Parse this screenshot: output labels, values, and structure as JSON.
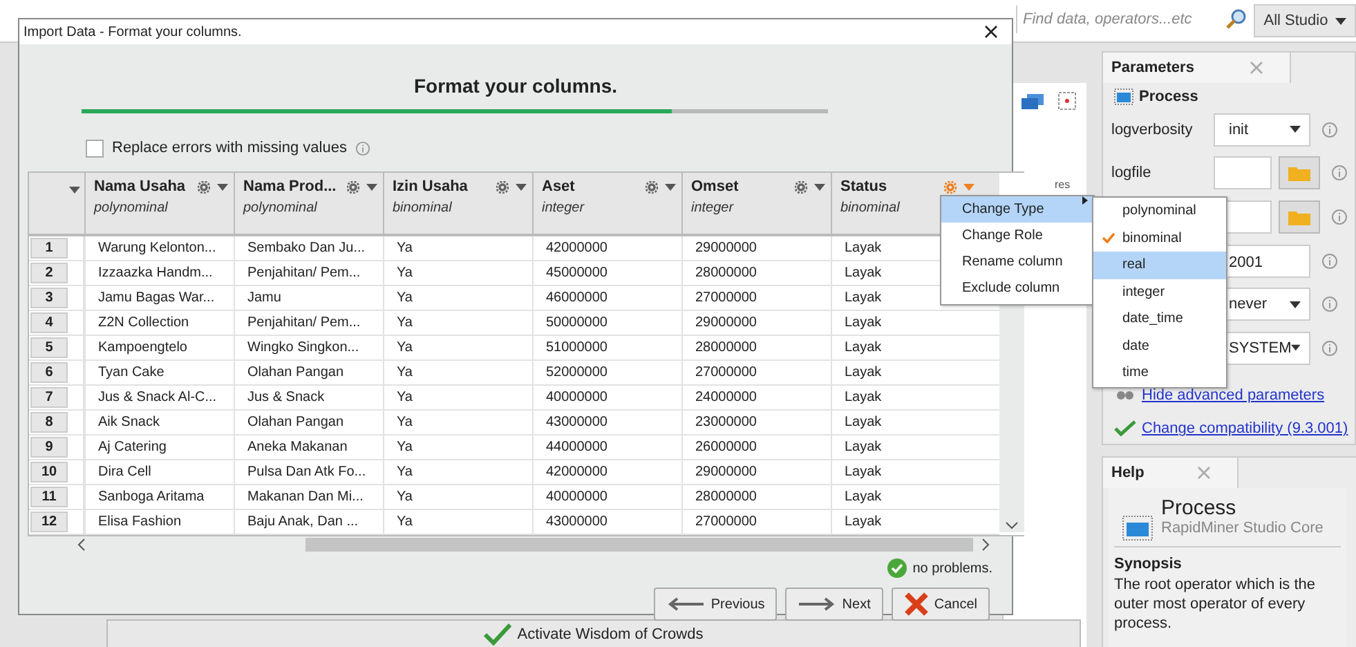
{
  "app": {
    "search": {
      "placeholder": "Find data, operators...etc"
    },
    "scope": "All Studio",
    "canvas_label": "res"
  },
  "parameters": {
    "tab": "Parameters",
    "operator": "Process",
    "rows": [
      {
        "label": "logverbosity",
        "kind": "select",
        "value": "init"
      },
      {
        "label": "logfile",
        "kind": "file"
      },
      {
        "kind": "file"
      },
      {
        "kind": "text",
        "value": "2001"
      },
      {
        "kind": "select",
        "value": "never"
      },
      {
        "kind": "select",
        "value": "SYSTEM"
      }
    ],
    "links": [
      {
        "label": "Hide advanced parameters",
        "kind": "hide"
      },
      {
        "label": "Change compatibility (9.3.001)",
        "kind": "check"
      }
    ]
  },
  "help": {
    "tab": "Help",
    "title": "Process",
    "subtitle": "RapidMiner Studio Core",
    "section": "Synopsis",
    "text": "The root operator which is the outer most operator of every process."
  },
  "wisdom_button": "Activate Wisdom of Crowds",
  "dialog": {
    "title": "Import Data - Format your columns.",
    "heading": "Format your columns.",
    "progress": {
      "level": 0.79
    },
    "replace_errors": {
      "label": "Replace errors with missing values",
      "checked": false
    },
    "columns": [
      {
        "name": "Nama Usaha",
        "type": "polynominal",
        "active": false
      },
      {
        "name": "Nama Prod...",
        "type": "polynominal",
        "active": false
      },
      {
        "name": "Izin Usaha",
        "type": "binominal",
        "active": false
      },
      {
        "name": "Aset",
        "type": "integer",
        "active": false
      },
      {
        "name": "Omset",
        "type": "integer",
        "active": false
      },
      {
        "name": "Status",
        "type": "binominal",
        "active": true
      }
    ],
    "rows": [
      {
        "num": "1",
        "cells": [
          "Warung Kelonton...",
          "Sembako Dan Ju...",
          "Ya",
          "42000000",
          "29000000",
          "Layak"
        ]
      },
      {
        "num": "2",
        "cells": [
          "Izzaazka Handm...",
          "Penjahitan/ Pem...",
          "Ya",
          "45000000",
          "28000000",
          "Layak"
        ]
      },
      {
        "num": "3",
        "cells": [
          "Jamu Bagas War...",
          "Jamu",
          "Ya",
          "46000000",
          "27000000",
          "Layak"
        ]
      },
      {
        "num": "4",
        "cells": [
          "Z2N Collection",
          "Penjahitan/ Pem...",
          "Ya",
          "50000000",
          "29000000",
          "Layak"
        ]
      },
      {
        "num": "5",
        "cells": [
          "Kampoengtelo",
          "Wingko Singkon...",
          "Ya",
          "51000000",
          "28000000",
          "Layak"
        ]
      },
      {
        "num": "6",
        "cells": [
          "Tyan Cake",
          "Olahan Pangan",
          "Ya",
          "52000000",
          "27000000",
          "Layak"
        ]
      },
      {
        "num": "7",
        "cells": [
          "Jus & Snack Al-C...",
          "Jus & Snack",
          "Ya",
          "40000000",
          "24000000",
          "Layak"
        ]
      },
      {
        "num": "8",
        "cells": [
          "Aik Snack",
          "Olahan Pangan",
          "Ya",
          "43000000",
          "23000000",
          "Layak"
        ]
      },
      {
        "num": "9",
        "cells": [
          "Aj Catering",
          "Aneka Makanan",
          "Ya",
          "44000000",
          "26000000",
          "Layak"
        ]
      },
      {
        "num": "10",
        "cells": [
          "Dira Cell",
          "Pulsa Dan Atk Fo...",
          "Ya",
          "42000000",
          "29000000",
          "Layak"
        ]
      },
      {
        "num": "11",
        "cells": [
          "Sanboga Aritama",
          "Makanan Dan Mi...",
          "Ya",
          "40000000",
          "28000000",
          "Layak"
        ]
      },
      {
        "num": "12",
        "cells": [
          "Elisa Fashion",
          "Baju Anak, Dan ...",
          "Ya",
          "43000000",
          "27000000",
          "Layak"
        ]
      }
    ],
    "status": "no problems.",
    "buttons": [
      {
        "label": "Previous",
        "kind": "previous"
      },
      {
        "label": "Next",
        "kind": "next"
      },
      {
        "label": "Cancel",
        "kind": "cancel"
      }
    ]
  },
  "column_menu": [
    {
      "label": "Change Type",
      "submenu": true,
      "selected": true
    },
    {
      "label": "Change Role",
      "submenu": false,
      "selected": false
    },
    {
      "label": "Rename column",
      "submenu": false,
      "selected": false
    },
    {
      "label": "Exclude column",
      "submenu": false,
      "selected": false
    }
  ],
  "type_menu": [
    {
      "label": "polynominal",
      "checked": false,
      "selected": false
    },
    {
      "label": "binominal",
      "checked": true,
      "selected": false
    },
    {
      "label": "real",
      "checked": false,
      "selected": true
    },
    {
      "label": "integer",
      "checked": false,
      "selected": false
    },
    {
      "label": "date_time",
      "checked": false,
      "selected": false
    },
    {
      "label": "date",
      "checked": false,
      "selected": false
    },
    {
      "label": "time",
      "checked": false,
      "selected": false
    }
  ]
}
